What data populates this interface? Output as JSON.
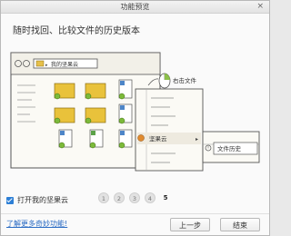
{
  "window": {
    "title": "功能预览",
    "close_glyph": "×"
  },
  "headline": "随时找回、比较文件的历史版本",
  "illustration": {
    "breadcrumb": "我的坚果云",
    "callout_label": "右击文件",
    "context_menu_item": "坚果云",
    "submenu_item": "文件历史"
  },
  "option": {
    "label": "打开我的坚果云",
    "checked": true
  },
  "pager": {
    "pages": [
      "1",
      "2",
      "3",
      "4",
      "5"
    ],
    "current": "5"
  },
  "footer": {
    "link": "了解更多奇妙功能!",
    "prev_button": "上一步",
    "finish_button": "结束"
  }
}
